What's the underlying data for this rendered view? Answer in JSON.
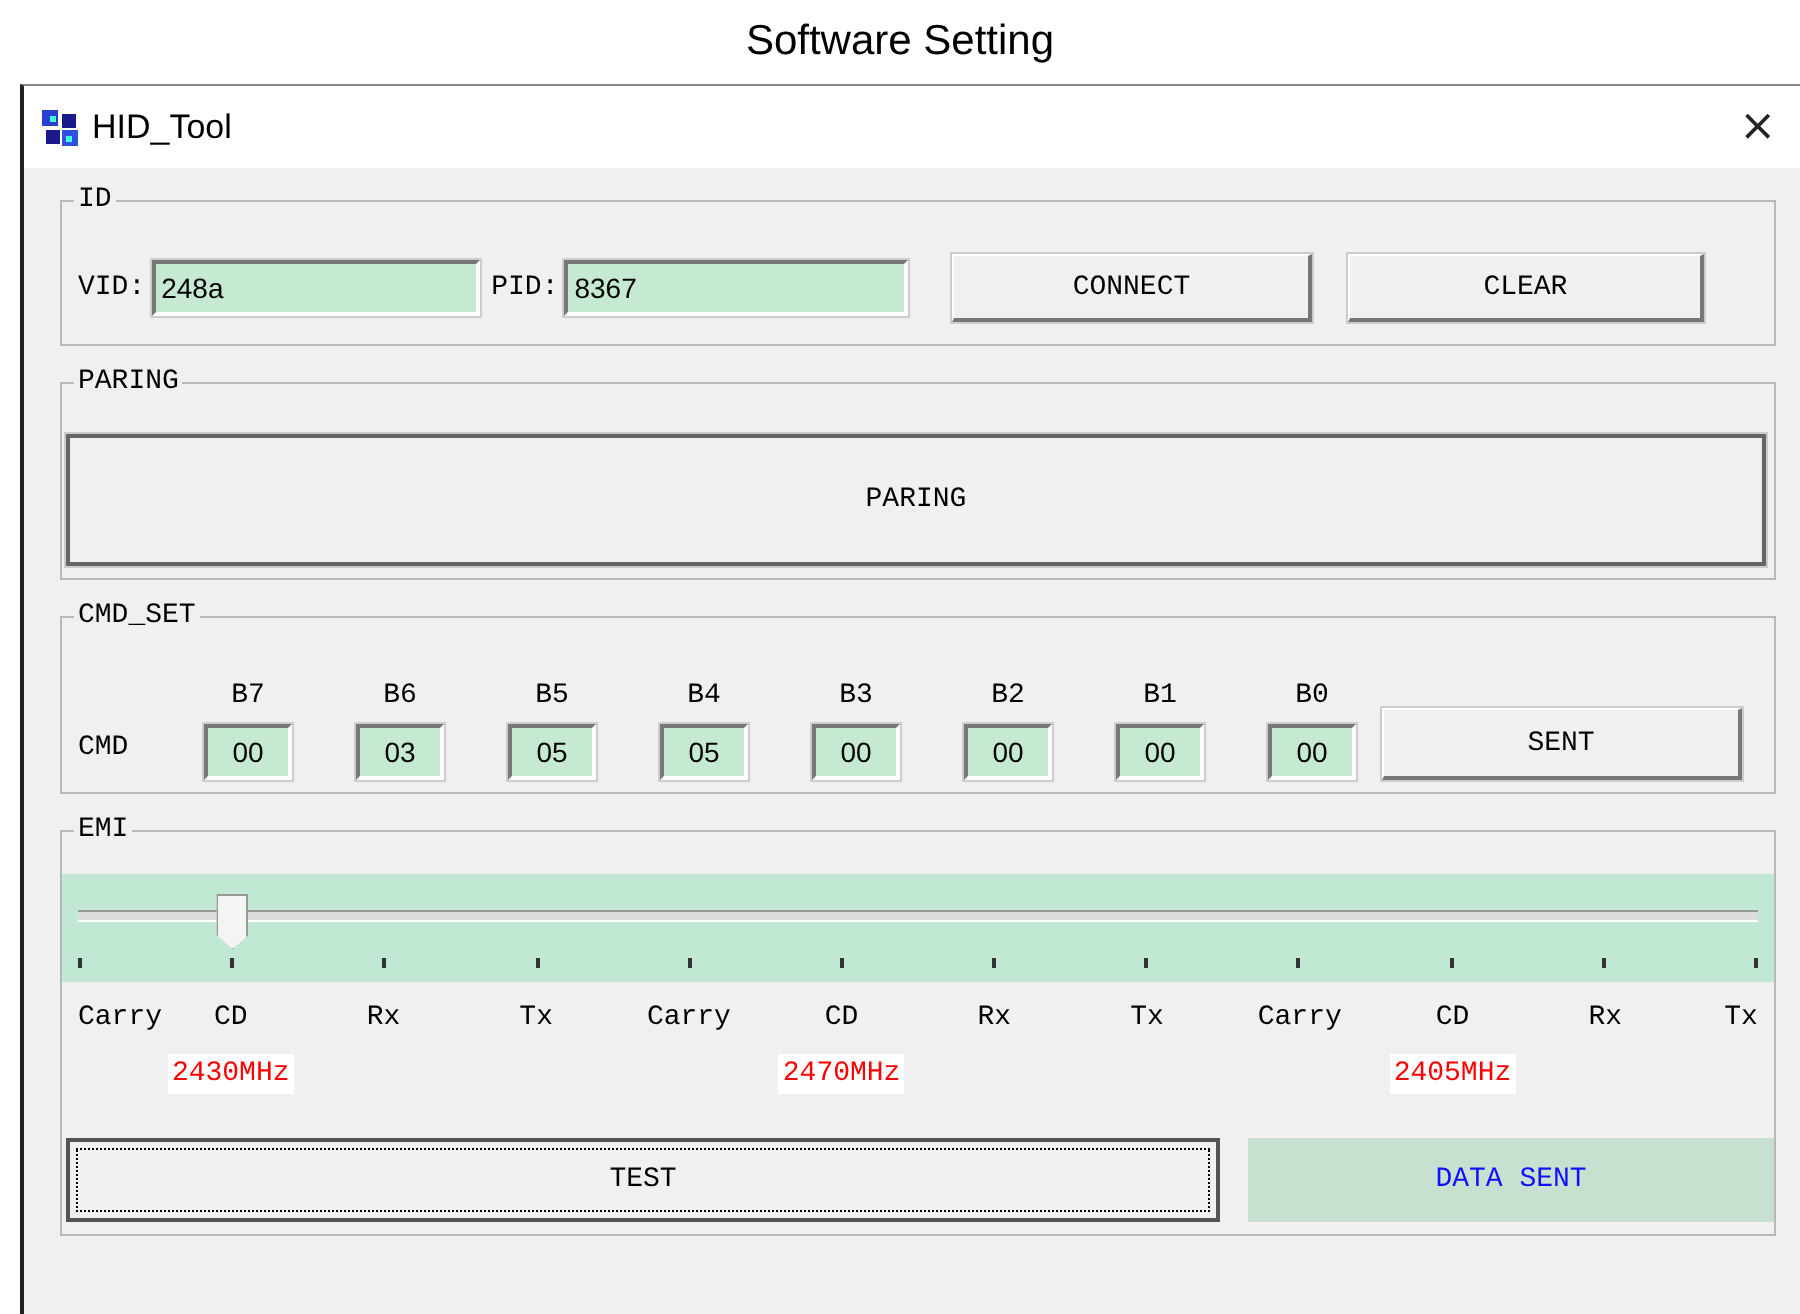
{
  "caption": "Software Setting",
  "window": {
    "title": "HID_Tool",
    "close": "×"
  },
  "id_group": {
    "legend": "ID",
    "fields": [
      {
        "label": "VID:",
        "value": "248a"
      },
      {
        "label": "PID:",
        "value": "8367"
      }
    ],
    "buttons": [
      "CONNECT",
      "CLEAR"
    ]
  },
  "paring_group": {
    "legend": "PARING",
    "button": "PARING"
  },
  "cmd_group": {
    "legend": "CMD_SET",
    "row_label": "CMD",
    "bytes": [
      {
        "label": "B7",
        "value": "00"
      },
      {
        "label": "B6",
        "value": "03"
      },
      {
        "label": "B5",
        "value": "05"
      },
      {
        "label": "B4",
        "value": "05"
      },
      {
        "label": "B3",
        "value": "00"
      },
      {
        "label": "B2",
        "value": "00"
      },
      {
        "label": "B1",
        "value": "00"
      },
      {
        "label": "B0",
        "value": "00"
      }
    ],
    "button": "SENT"
  },
  "emi_group": {
    "legend": "EMI",
    "slider": {
      "level": 0.0909
    },
    "ticks": [
      {
        "label": "Carry"
      },
      {
        "label": "CD",
        "freq": "2430MHz"
      },
      {
        "label": "Rx"
      },
      {
        "label": "Tx"
      },
      {
        "label": "Carry"
      },
      {
        "label": "CD",
        "freq": "2470MHz"
      },
      {
        "label": "Rx"
      },
      {
        "label": "Tx"
      },
      {
        "label": "Carry"
      },
      {
        "label": "CD",
        "freq": "2405MHz"
      },
      {
        "label": "Rx"
      },
      {
        "label": "Tx"
      }
    ],
    "test_button": {
      "label": "TEST",
      "focused": true
    },
    "status": "DATA SENT"
  }
}
